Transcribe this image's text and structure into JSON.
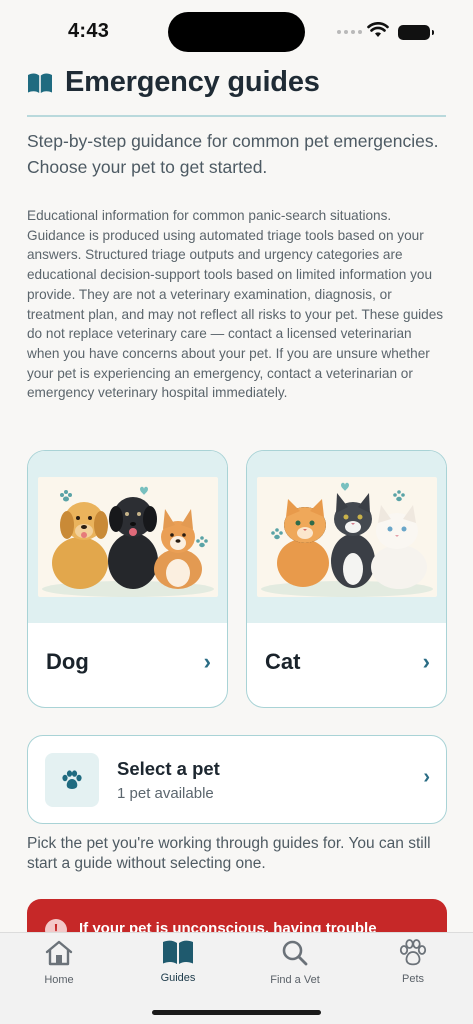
{
  "status_bar": {
    "time": "4:43"
  },
  "header": {
    "title": "Emergency guides",
    "icon": "book-open-icon"
  },
  "subtitle": "Step-by-step guidance for common pet emergencies. Choose your pet to get started.",
  "disclaimer": "Educational information for common panic-search situations. Guidance is produced using automated triage tools based on your answers. Structured triage outputs and urgency categories are educational decision-support tools based on limited information you provide. They are not a veterinary examination, diagnosis, or treatment plan, and may not reflect all risks to your pet. These guides do not replace veterinary care — contact a licensed veterinarian when you have concerns about your pet. If you are unsure whether your pet is experiencing an emergency, contact a veterinarian or emergency veterinary hospital immediately.",
  "pets": [
    {
      "name": "Dog",
      "icon": "chevron-right-icon"
    },
    {
      "name": "Cat",
      "icon": "chevron-right-icon"
    }
  ],
  "select_pet": {
    "title": "Select a pet",
    "subtitle": "1 pet available",
    "help": "Pick the pet you're working through guides for. You can still start a guide without selecting one."
  },
  "alert": {
    "text": "If your pet is unconscious, having trouble",
    "color": "#c62828"
  },
  "tabs": [
    {
      "label": "Home",
      "icon": "home-icon"
    },
    {
      "label": "Guides",
      "icon": "book-open-icon",
      "active": true
    },
    {
      "label": "Find a Vet",
      "icon": "search-icon"
    },
    {
      "label": "Pets",
      "icon": "paw-icon"
    }
  ],
  "colors": {
    "accent": "#1f6b80",
    "border": "#a9d3d6",
    "alert": "#c62828"
  }
}
